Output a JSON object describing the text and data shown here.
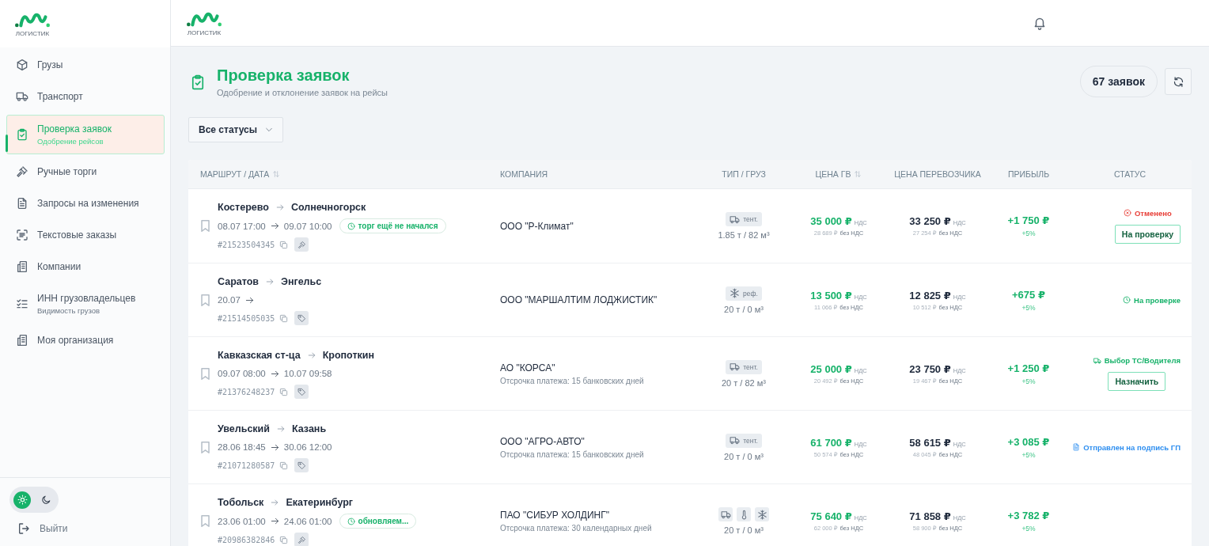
{
  "sidebar": {
    "logo_caption": "ЛОГИСТИК",
    "items": [
      {
        "label": "Грузы",
        "selected": false
      },
      {
        "label": "Транспорт",
        "selected": false
      },
      {
        "label": "Проверка заявок",
        "sublabel": "Одобрение рейсов",
        "selected": true
      },
      {
        "label": "Ручные торги",
        "selected": false
      },
      {
        "label": "Запросы на изменения",
        "selected": false
      },
      {
        "label": "Текстовые заказы",
        "selected": false
      },
      {
        "label": "Компании",
        "selected": false
      },
      {
        "label": "ИНН грузовладельцев",
        "sublabel": "Видимость грузов",
        "selected": false
      },
      {
        "label": "Моя организация",
        "selected": false
      }
    ],
    "theme": [
      {
        "kind": "light",
        "selected": true
      },
      {
        "kind": "dark",
        "selected": false
      }
    ],
    "logout": "Выйти"
  },
  "header": {
    "logo_caption": "ЛОГИСТИК"
  },
  "page": {
    "title": "Проверка заявок",
    "subtitle": "Одобрение и отклонение заявок на рейсы",
    "count": "67 заявок",
    "filter": "Все статусы"
  },
  "table": {
    "columns": [
      {
        "label": "МАРШРУТ / ДАТА",
        "sortable": true
      },
      {
        "label": "КОМПАНИЯ",
        "sortable": false
      },
      {
        "label": "ТИП / ГРУЗ",
        "sortable": false
      },
      {
        "label": "ЦЕНА ГВ",
        "sortable": true
      },
      {
        "label": "ЦЕНА ПЕРЕВОЗЧИКА",
        "sortable": false
      },
      {
        "label": "ПРИБЫЛЬ",
        "sortable": false
      },
      {
        "label": "СТАТУС",
        "sortable": false
      }
    ],
    "rows": [
      {
        "kind": "auction",
        "from": "Костерево",
        "to": "Солнечногорск",
        "depart": "08.07 17:00",
        "arrive": "09.07 10:00",
        "badge": "торг ещё не начался",
        "id": "#21523504345",
        "company": "ООО \"Р-Климат\"",
        "vehicle": [
          {
            "kind": "tent",
            "label": "тент."
          }
        ],
        "load": "1.85 т / 82 м³",
        "price_gv": {
          "gross": "35 000 ₽",
          "gross_label": "НДС",
          "net": "28 689 ₽",
          "net_label": "без НДС"
        },
        "price_carrier": {
          "gross": "33 250 ₽",
          "gross_label": "НДС",
          "net": "27 254 ₽",
          "net_label": "без НДС"
        },
        "profit": {
          "amount": "+1 750 ₽",
          "percent": "+5%"
        },
        "status": {
          "kind": "cancelled",
          "label": "Отменено",
          "action": "На проверку"
        }
      },
      {
        "kind": "tag",
        "from": "Саратов",
        "to": "Энгельс",
        "depart": "20.07",
        "id": "#21514505035",
        "company": "ООО \"МАРШАЛТИМ ЛОДЖИСТИК\"",
        "vehicle": [
          {
            "kind": "reefer",
            "label": "реф."
          }
        ],
        "load": "20 т / 0 м³",
        "price_gv": {
          "gross": "13 500 ₽",
          "gross_label": "НДС",
          "net": "11 066 ₽",
          "net_label": "без НДС"
        },
        "price_carrier": {
          "gross": "12 825 ₽",
          "gross_label": "НДС",
          "net": "10 512 ₽",
          "net_label": "без НДС"
        },
        "profit": {
          "amount": "+675 ₽",
          "percent": "+5%"
        },
        "status": {
          "kind": "review",
          "label": "На проверке"
        }
      },
      {
        "kind": "tag",
        "from": "Кавказская ст-ца",
        "to": "Кропоткин",
        "depart": "09.07 08:00",
        "arrive": "10.07 09:58",
        "id": "#21376248237",
        "company": "АО \"КОРСА\"",
        "note": "Отсрочка платежа: 15 банковских дней",
        "vehicle": [
          {
            "kind": "tent",
            "label": "тент."
          }
        ],
        "load": "20 т / 82 м³",
        "price_gv": {
          "gross": "25 000 ₽",
          "gross_label": "НДС",
          "net": "20 492 ₽",
          "net_label": "без НДС"
        },
        "price_carrier": {
          "gross": "23 750 ₽",
          "gross_label": "НДС",
          "net": "19 467 ₽",
          "net_label": "без НДС"
        },
        "profit": {
          "amount": "+1 250 ₽",
          "percent": "+5%"
        },
        "status": {
          "kind": "vehicle",
          "label": "Выбор ТС/Водителя",
          "action": "Назначить"
        }
      },
      {
        "kind": "tag",
        "from": "Увельский",
        "to": "Казань",
        "depart": "28.06 18:45",
        "arrive": "30.06 12:00",
        "id": "#21071280587",
        "company": "ООО \"АГРО-АВТО\"",
        "note": "Отсрочка платежа: 15 банковских дней",
        "vehicle": [
          {
            "kind": "tent",
            "label": "тент."
          }
        ],
        "load": "20 т / 0 м³",
        "price_gv": {
          "gross": "61 700 ₽",
          "gross_label": "НДС",
          "net": "50 574 ₽",
          "net_label": "без НДС"
        },
        "price_carrier": {
          "gross": "58 615 ₽",
          "gross_label": "НДС",
          "net": "48 045 ₽",
          "net_label": "без НДС"
        },
        "profit": {
          "amount": "+3 085 ₽",
          "percent": "+5%"
        },
        "status": {
          "kind": "signing",
          "label": "Отправлен на подпись ГП"
        }
      },
      {
        "kind": "auction",
        "from": "Тобольск",
        "to": "Екатеринбург",
        "depart": "23.06 01:00",
        "arrive": "24.06 01:00",
        "badge": "обновляем...",
        "id": "#20986382846",
        "company": "ПАО \"СИБУР ХОЛДИНГ\"",
        "note": "Отсрочка платежа: 30 календарных дней",
        "vehicle": [
          {
            "kind": "tent"
          },
          {
            "kind": "isotherm"
          },
          {
            "kind": "reefer"
          }
        ],
        "load": "20 т / 0 м³",
        "price_gv": {
          "gross": "75 640 ₽",
          "gross_label": "НДС",
          "net": "62 000 ₽",
          "net_label": "без НДС"
        },
        "price_carrier": {
          "gross": "71 858 ₽",
          "gross_label": "НДС",
          "net": "58 900 ₽",
          "net_label": "без НДС"
        },
        "profit": {
          "amount": "+3 782 ₽",
          "percent": "+5%"
        }
      }
    ]
  }
}
